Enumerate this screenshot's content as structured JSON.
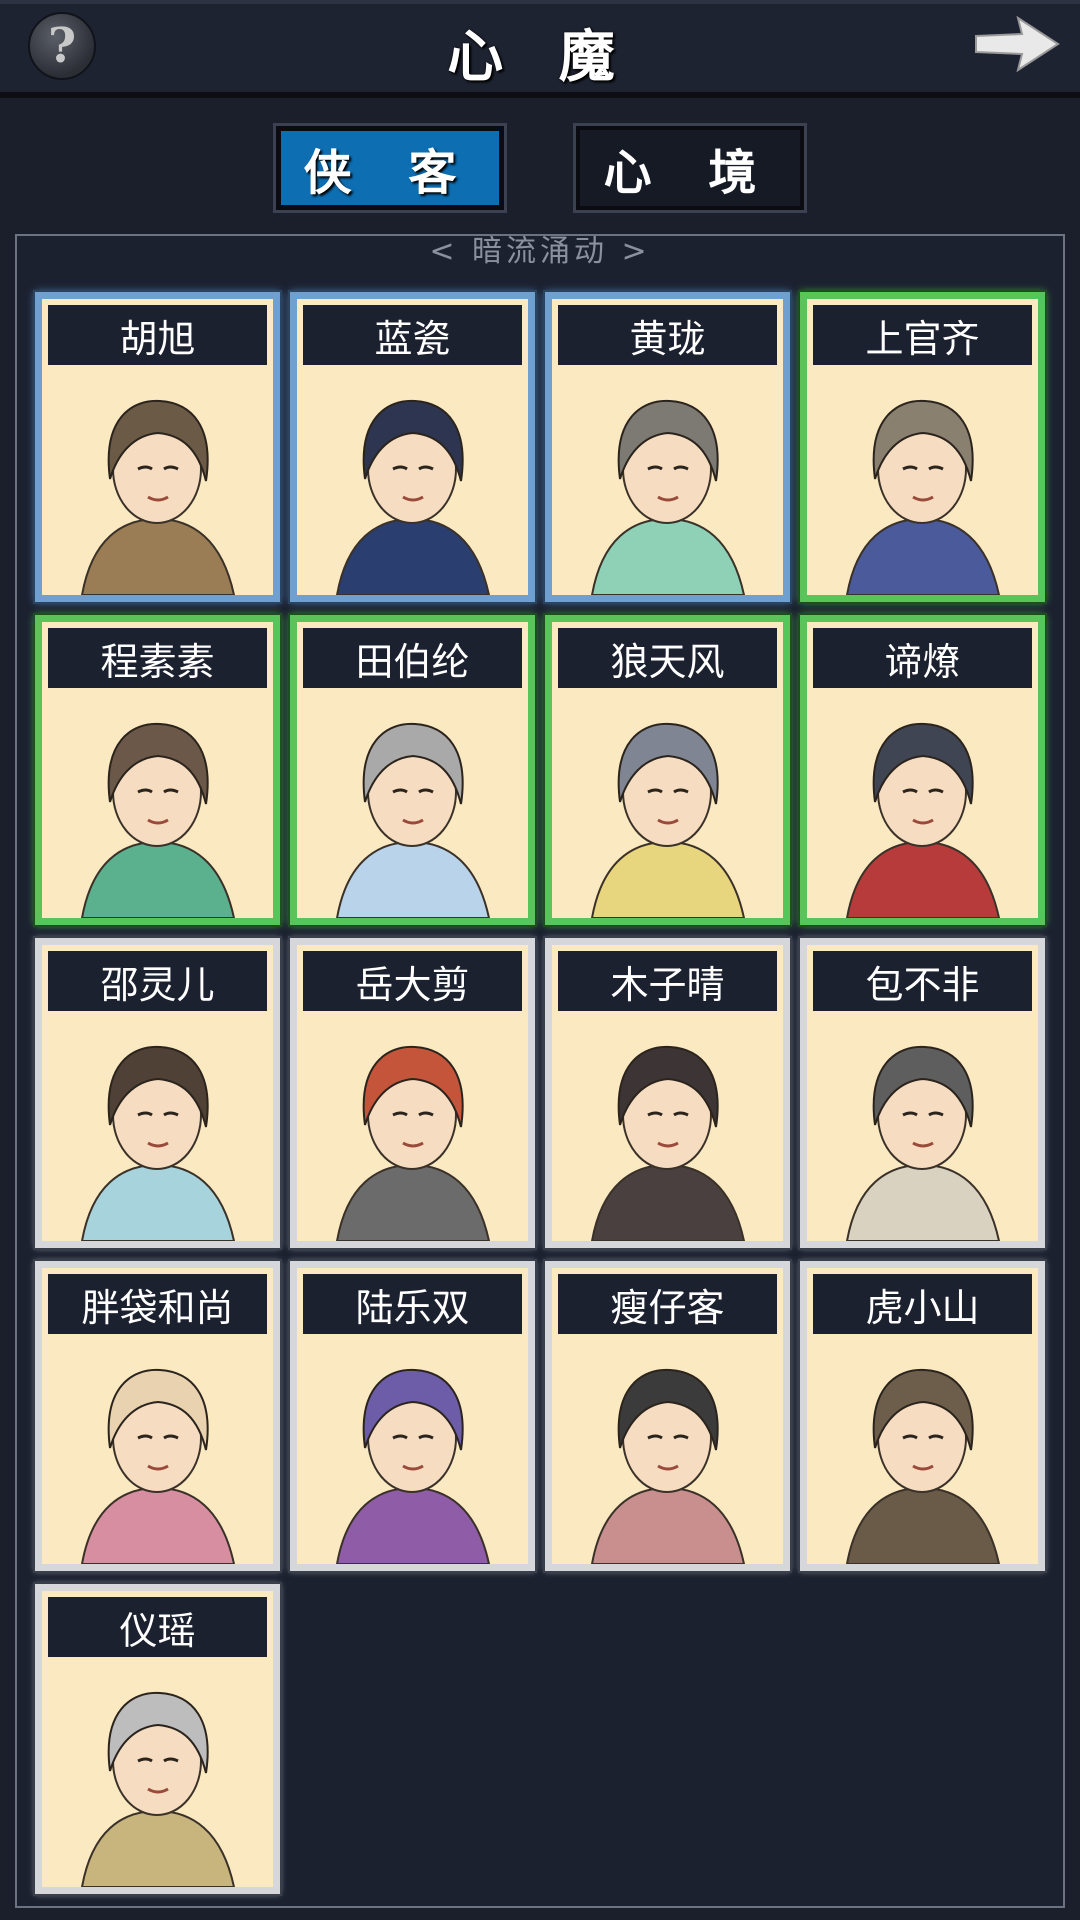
{
  "header": {
    "title": "心 魔",
    "help_icon": "?",
    "next_icon": "right-arrow-icon"
  },
  "tabs": [
    {
      "label": "侠 客",
      "selected": true
    },
    {
      "label": "心 境",
      "selected": false
    }
  ],
  "panel": {
    "scroll_hint": "< 暗流涌动 >"
  },
  "characters": [
    {
      "name": "胡旭",
      "frame": "blue",
      "hair": "#6b5a45",
      "cloth": "#9a7c55"
    },
    {
      "name": "蓝瓷",
      "frame": "blue",
      "hair": "#2e3550",
      "cloth": "#2b3e70"
    },
    {
      "name": "黄珑",
      "frame": "blue",
      "hair": "#7d7a73",
      "cloth": "#8fd1b6"
    },
    {
      "name": "上官齐",
      "frame": "green",
      "hair": "#8a806f",
      "cloth": "#4a5a9a"
    },
    {
      "name": "程素素",
      "frame": "green",
      "hair": "#6b5848",
      "cloth": "#5bb08e"
    },
    {
      "name": "田伯纶",
      "frame": "green",
      "hair": "#a9a9a9",
      "cloth": "#b8d3ea"
    },
    {
      "name": "狼天风",
      "frame": "green",
      "hair": "#7f8592",
      "cloth": "#e8d67e"
    },
    {
      "name": "谛燎",
      "frame": "green",
      "hair": "#3f4552",
      "cloth": "#b83b3b"
    },
    {
      "name": "邵灵儿",
      "frame": "gray",
      "hair": "#4f4136",
      "cloth": "#a6d3dc"
    },
    {
      "name": "岳大剪",
      "frame": "gray",
      "hair": "#c4553a",
      "cloth": "#6b6b6b"
    },
    {
      "name": "木子晴",
      "frame": "gray",
      "hair": "#3d3535",
      "cloth": "#4a4040"
    },
    {
      "name": "包不非",
      "frame": "gray",
      "hair": "#5e5e5e",
      "cloth": "#d9d2c0"
    },
    {
      "name": "胖袋和尚",
      "frame": "gray",
      "hair": "#e8d2b0",
      "cloth": "#d78ea0"
    },
    {
      "name": "陆乐双",
      "frame": "gray",
      "hair": "#6d5da8",
      "cloth": "#8f5ca8"
    },
    {
      "name": "瘦仔客",
      "frame": "gray",
      "hair": "#3b3b3b",
      "cloth": "#c98f8f"
    },
    {
      "name": "虎小山",
      "frame": "gray",
      "hair": "#6d5e4c",
      "cloth": "#6a5a48"
    },
    {
      "name": "仪瑶",
      "frame": "gray",
      "hair": "#bdbdbd",
      "cloth": "#c8b57e"
    }
  ]
}
